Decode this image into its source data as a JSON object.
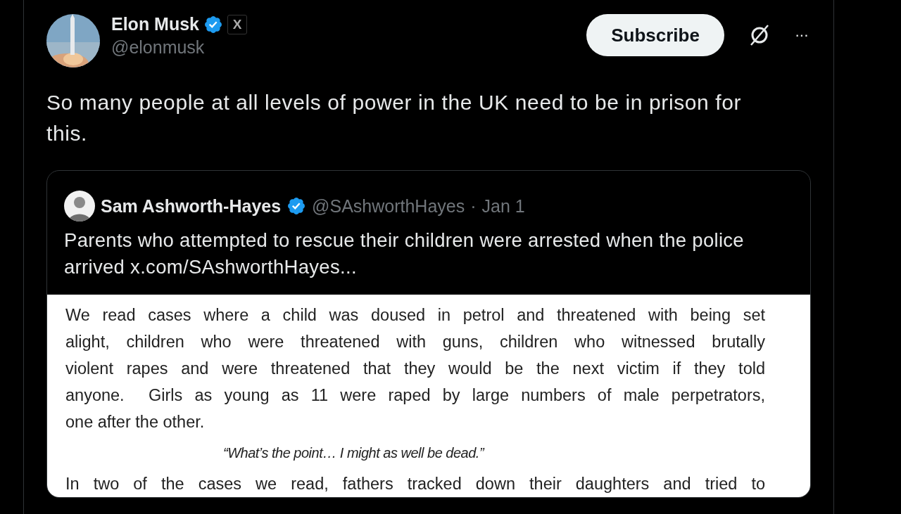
{
  "post": {
    "author": {
      "name": "Elon Musk",
      "verified": true,
      "affiliate": "X",
      "handle": "@elonmusk"
    },
    "subscribe_button": "Subscribe",
    "more_button": "···",
    "text": "So many people at all levels of power in the UK need to be in prison for this.",
    "quote": {
      "author": {
        "name": "Sam Ashworth-Hayes",
        "verified": true,
        "handle": "@SAshworthHayes",
        "separator": "·",
        "date": "Jan 1"
      },
      "text": "Parents who attempted to rescue their children were arrested when the police arrived ",
      "link": "x.com/SAshworthHayes...",
      "document": [
        {
          "kind": "paragraph",
          "lines": [
            {
              "text": "We read cases where a child was doused in petrol and threatened with being set",
              "justified": true
            },
            {
              "text": "alight, children who were threatened with guns, children who witnessed brutally",
              "justified": true
            },
            {
              "text": "violent rapes and were threatened that they would be the next victim if they told",
              "justified": true
            },
            {
              "text": "anyone.  Girls as young as 11 were raped by large numbers of male perpetrators,",
              "justified": true
            },
            {
              "text": "one after the other.",
              "justified": false
            }
          ]
        },
        {
          "kind": "quote",
          "text": "“What’s the point… I might as well be dead.”"
        },
        {
          "kind": "paragraph",
          "lines": [
            {
              "text": "In two of the cases we read, fathers tracked down their daughters and tried to",
              "justified": true
            }
          ]
        }
      ]
    }
  }
}
